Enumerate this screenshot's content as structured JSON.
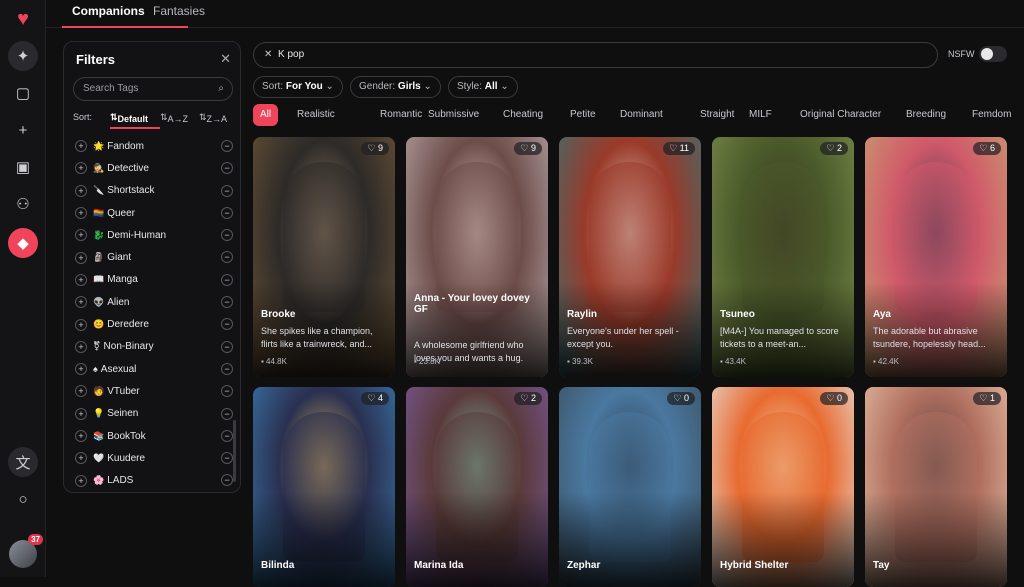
{
  "nav": {
    "tabs": [
      "Companions",
      "Fantasies"
    ]
  },
  "rail": {
    "notification_count": "37"
  },
  "filters": {
    "title": "Filters",
    "search_placeholder": "Search Tags",
    "sort_label": "Sort:",
    "sort_options": [
      "Default",
      "A→Z",
      "Z→A"
    ],
    "tags": [
      {
        "icon": "🌟",
        "label": "Fandom"
      },
      {
        "icon": "🕵",
        "label": "Detective"
      },
      {
        "icon": "🔪",
        "label": "Shortstack"
      },
      {
        "icon": "🏳️‍🌈",
        "label": "Queer"
      },
      {
        "icon": "🐉",
        "label": "Demi-Human"
      },
      {
        "icon": "🗿",
        "label": "Giant"
      },
      {
        "icon": "📖",
        "label": "Manga"
      },
      {
        "icon": "👽",
        "label": "Alien"
      },
      {
        "icon": "😊",
        "label": "Deredere"
      },
      {
        "icon": "⚧",
        "label": "Non-Binary"
      },
      {
        "icon": "♠",
        "label": "Asexual"
      },
      {
        "icon": "🧑",
        "label": "VTuber"
      },
      {
        "icon": "💡",
        "label": "Seinen"
      },
      {
        "icon": "📚",
        "label": "BookTok"
      },
      {
        "icon": "🤍",
        "label": "Kuudere"
      },
      {
        "icon": "🌸",
        "label": "LADS"
      }
    ]
  },
  "search": {
    "value": "K pop"
  },
  "nsfw": {
    "label": "NSFW",
    "enabled": false
  },
  "dropdowns": [
    {
      "label": "Sort:",
      "value": "For You"
    },
    {
      "label": "Gender:",
      "value": "Girls"
    },
    {
      "label": "Style:",
      "value": "All"
    }
  ],
  "categories": [
    "All",
    "Realistic",
    "Romantic",
    "Submissive",
    "Cheating",
    "Petite",
    "Dominant",
    "Straight",
    "MILF",
    "Original Character",
    "Breeding",
    "Femdom"
  ],
  "cards": [
    {
      "name": "Brooke",
      "desc": "She spikes like a champion, flirts like a trainwreck, and...",
      "stat": "44.8K",
      "likes": "9",
      "colors": [
        "#6b5436",
        "#2d2a28",
        "#a08870"
      ]
    },
    {
      "name": "Anna - Your lovey dovey GF",
      "desc": "A wholesome girlfriend who loves you and wants a hug.",
      "stat": "23.8K",
      "likes": "9",
      "colors": [
        "#b8a8a8",
        "#6d4d4a",
        "#e8d0c8"
      ]
    },
    {
      "name": "Raylin",
      "desc": "Everyone's under her spell - except you.",
      "stat": "39.3K",
      "likes": "11",
      "colors": [
        "#3a6f70",
        "#9a3a2a",
        "#e8d8d0"
      ]
    },
    {
      "name": "Tsuneo",
      "desc": "[M4A-] You managed to score tickets to a meet-an...",
      "stat": "43.4K",
      "likes": "2",
      "colors": [
        "#7a8a4a",
        "#4a5a2a",
        "#3a3020"
      ]
    },
    {
      "name": "Aya",
      "desc": "The adorable but abrasive tsundere, hopelessly head...",
      "stat": "42.4K",
      "likes": "6",
      "colors": [
        "#c8a070",
        "#d05a6a",
        "#3a3450"
      ]
    },
    {
      "name": "Bilinda",
      "desc": "",
      "stat": "",
      "likes": "4",
      "colors": [
        "#3a7ab0",
        "#2a3050",
        "#d8b060"
      ]
    },
    {
      "name": "Marina Ida",
      "desc": "",
      "stat": "",
      "likes": "2",
      "colors": [
        "#7a5a9a",
        "#5a3a3a",
        "#80c0a0"
      ]
    },
    {
      "name": "Zephar",
      "desc": "",
      "stat": "",
      "likes": "0",
      "colors": [
        "#3a5060",
        "#4a78a0",
        "#2a3a48"
      ]
    },
    {
      "name": "Hybrid Shelter",
      "desc": "",
      "stat": "",
      "likes": "0",
      "colors": [
        "#e8e0d8",
        "#e86a30",
        "#f0d8b0"
      ]
    },
    {
      "name": "Tay",
      "desc": "",
      "stat": "",
      "likes": "1",
      "colors": [
        "#e8c0a8",
        "#b07060",
        "#504040"
      ]
    }
  ]
}
